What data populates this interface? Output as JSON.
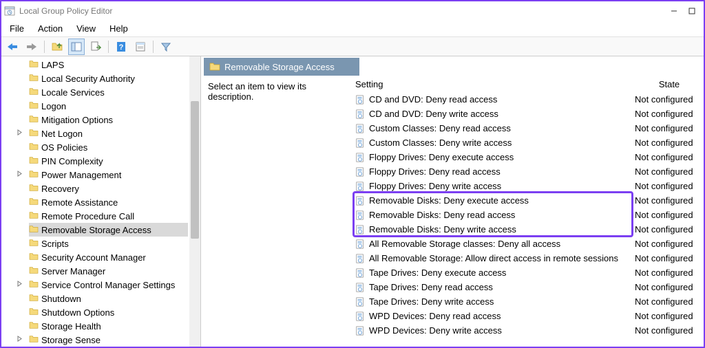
{
  "window": {
    "title": "Local Group Policy Editor"
  },
  "menu": {
    "items": [
      "File",
      "Action",
      "View",
      "Help"
    ]
  },
  "toolbar": {
    "buttons": [
      "back",
      "forward",
      "up",
      "window",
      "export",
      "help-doc",
      "props",
      "filter"
    ]
  },
  "tree": {
    "nodes": [
      {
        "label": "LAPS",
        "expandable": false
      },
      {
        "label": "Local Security Authority",
        "expandable": false
      },
      {
        "label": "Locale Services",
        "expandable": false
      },
      {
        "label": "Logon",
        "expandable": false
      },
      {
        "label": "Mitigation Options",
        "expandable": false
      },
      {
        "label": "Net Logon",
        "expandable": true
      },
      {
        "label": "OS Policies",
        "expandable": false
      },
      {
        "label": "PIN Complexity",
        "expandable": false
      },
      {
        "label": "Power Management",
        "expandable": true
      },
      {
        "label": "Recovery",
        "expandable": false
      },
      {
        "label": "Remote Assistance",
        "expandable": false
      },
      {
        "label": "Remote Procedure Call",
        "expandable": false
      },
      {
        "label": "Removable Storage Access",
        "expandable": false,
        "selected": true
      },
      {
        "label": "Scripts",
        "expandable": false
      },
      {
        "label": "Security Account Manager",
        "expandable": false
      },
      {
        "label": "Server Manager",
        "expandable": false
      },
      {
        "label": "Service Control Manager Settings",
        "expandable": true
      },
      {
        "label": "Shutdown",
        "expandable": false
      },
      {
        "label": "Shutdown Options",
        "expandable": false
      },
      {
        "label": "Storage Health",
        "expandable": false
      },
      {
        "label": "Storage Sense",
        "expandable": true
      }
    ]
  },
  "main": {
    "header_title": "Removable Storage Access",
    "description_prompt": "Select an item to view its description.",
    "columns": {
      "setting": "Setting",
      "state": "State"
    },
    "default_state": "Not configured",
    "settings": [
      {
        "label": "CD and DVD: Deny read access"
      },
      {
        "label": "CD and DVD: Deny write access"
      },
      {
        "label": "Custom Classes: Deny read access"
      },
      {
        "label": "Custom Classes: Deny write access"
      },
      {
        "label": "Floppy Drives: Deny execute access"
      },
      {
        "label": "Floppy Drives: Deny read access"
      },
      {
        "label": "Floppy Drives: Deny write access"
      },
      {
        "label": "Removable Disks: Deny execute access",
        "highlighted": true
      },
      {
        "label": "Removable Disks: Deny read access",
        "highlighted": true
      },
      {
        "label": "Removable Disks: Deny write access",
        "highlighted": true
      },
      {
        "label": "All Removable Storage classes: Deny all access"
      },
      {
        "label": "All Removable Storage: Allow direct access in remote sessions"
      },
      {
        "label": "Tape Drives: Deny execute access"
      },
      {
        "label": "Tape Drives: Deny read access"
      },
      {
        "label": "Tape Drives: Deny write access"
      },
      {
        "label": "WPD Devices: Deny read access"
      },
      {
        "label": "WPD Devices: Deny write access"
      }
    ]
  }
}
